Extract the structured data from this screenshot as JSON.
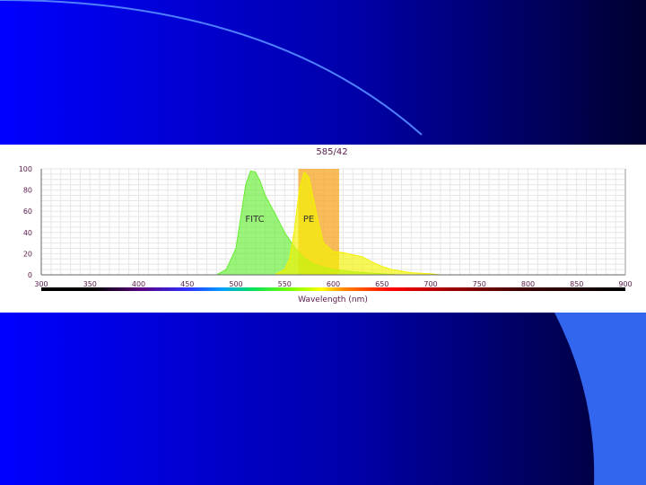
{
  "slide": {
    "background_colors": [
      "#0000ff",
      "#0000a8",
      "#000030"
    ],
    "accent_color": "#3366ee"
  },
  "chart_data": {
    "type": "area",
    "title": "585/42",
    "xlabel": "Wavelength (nm)",
    "ylabel": "",
    "xlim": [
      300,
      900
    ],
    "ylim": [
      0,
      100
    ],
    "x_ticks": [
      300,
      350,
      400,
      450,
      500,
      550,
      600,
      650,
      700,
      750,
      800,
      850,
      900
    ],
    "y_ticks": [
      0,
      20,
      40,
      60,
      80,
      100
    ],
    "grid": true,
    "filter_band": {
      "name": "585/42",
      "from": 564,
      "to": 606,
      "color": "#f5a623"
    },
    "series": [
      {
        "name": "FITC",
        "color": "#66ee33",
        "x": [
          480,
          490,
          500,
          505,
          510,
          515,
          520,
          525,
          530,
          540,
          550,
          560,
          570,
          580,
          600,
          620,
          650,
          670
        ],
        "values": [
          0,
          5,
          25,
          55,
          85,
          98,
          97,
          88,
          75,
          58,
          40,
          26,
          16,
          10,
          5,
          3,
          1,
          0
        ]
      },
      {
        "name": "PE",
        "color": "#f2f200",
        "x": [
          540,
          550,
          555,
          560,
          565,
          570,
          575,
          580,
          585,
          590,
          600,
          610,
          620,
          630,
          640,
          650,
          660,
          680,
          700,
          710
        ],
        "values": [
          0,
          5,
          15,
          42,
          80,
          97,
          92,
          70,
          48,
          30,
          22,
          21,
          19,
          17,
          12,
          8,
          5,
          2,
          1,
          0
        ]
      }
    ]
  }
}
